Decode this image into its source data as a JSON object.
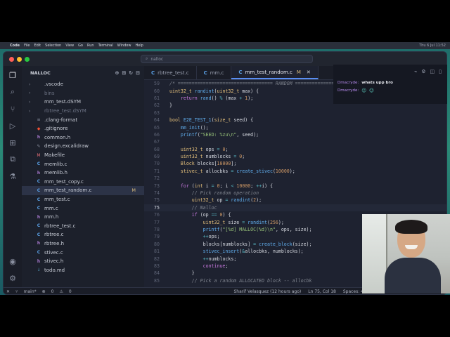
{
  "menubar": {
    "app": "Code",
    "items": [
      "File",
      "Edit",
      "Selection",
      "View",
      "Go",
      "Run",
      "Terminal",
      "Window",
      "Help"
    ],
    "clock": "Thu 6 Jul 11:52"
  },
  "window": {
    "search": "nalloc"
  },
  "sidebar": {
    "title": "NALLOC",
    "items": [
      {
        "label": ".vscode",
        "kind": "folder",
        "dim": false,
        "selected": false,
        "badge": ""
      },
      {
        "label": "bins",
        "kind": "folder",
        "dim": true,
        "selected": false,
        "badge": ""
      },
      {
        "label": "mm_test.dSYM",
        "kind": "folder",
        "dim": false,
        "selected": false,
        "badge": ""
      },
      {
        "label": "rbtree_test.dSYM",
        "kind": "folder",
        "dim": true,
        "selected": false,
        "badge": ""
      },
      {
        "label": ".clang-format",
        "kind": "clang",
        "dim": false,
        "selected": false,
        "badge": ""
      },
      {
        "label": ".gitignore",
        "kind": "git",
        "dim": false,
        "selected": false,
        "badge": ""
      },
      {
        "label": "common.h",
        "kind": "h",
        "dim": false,
        "selected": false,
        "badge": ""
      },
      {
        "label": "design.excalidraw",
        "kind": "draw",
        "dim": false,
        "selected": false,
        "badge": ""
      },
      {
        "label": "Makefile",
        "kind": "make",
        "dim": false,
        "selected": false,
        "badge": ""
      },
      {
        "label": "memlib.c",
        "kind": "c",
        "dim": false,
        "selected": false,
        "badge": ""
      },
      {
        "label": "memlib.h",
        "kind": "h",
        "dim": false,
        "selected": false,
        "badge": ""
      },
      {
        "label": "mm_test_copy.c",
        "kind": "c",
        "dim": false,
        "selected": false,
        "badge": ""
      },
      {
        "label": "mm_test_random.c",
        "kind": "c",
        "dim": false,
        "selected": true,
        "badge": "M"
      },
      {
        "label": "mm_test.c",
        "kind": "c",
        "dim": false,
        "selected": false,
        "badge": ""
      },
      {
        "label": "mm.c",
        "kind": "c",
        "dim": false,
        "selected": false,
        "badge": ""
      },
      {
        "label": "mm.h",
        "kind": "h",
        "dim": false,
        "selected": false,
        "badge": ""
      },
      {
        "label": "rbtree_test.c",
        "kind": "c",
        "dim": false,
        "selected": false,
        "badge": ""
      },
      {
        "label": "rbtree.c",
        "kind": "c",
        "dim": false,
        "selected": false,
        "badge": ""
      },
      {
        "label": "rbtree.h",
        "kind": "h",
        "dim": false,
        "selected": false,
        "badge": ""
      },
      {
        "label": "stivec.c",
        "kind": "c",
        "dim": false,
        "selected": false,
        "badge": ""
      },
      {
        "label": "stivec.h",
        "kind": "h",
        "dim": false,
        "selected": false,
        "badge": ""
      },
      {
        "label": "todo.md",
        "kind": "md",
        "dim": false,
        "selected": false,
        "badge": ""
      }
    ]
  },
  "tabs": [
    {
      "label": "rbtree_test.c",
      "active": false,
      "modified": ""
    },
    {
      "label": "mm.c",
      "active": false,
      "modified": ""
    },
    {
      "label": "mm_test_random.c",
      "active": true,
      "modified": "M"
    }
  ],
  "code": {
    "current_line": 75,
    "lines": [
      {
        "n": 59,
        "html": "<span class='cm'>/* ================================== RANDOM ==============</span>"
      },
      {
        "n": 60,
        "html": "<span class='ty'>uint32_t</span> <span class='fn'>randint</span>(<span class='ty'>uint32_t</span> max) {"
      },
      {
        "n": 61,
        "html": "    <span class='kw'>return</span> <span class='fn'>rand</span>() <span class='op'>%</span> (max <span class='op'>+</span> <span class='nu'>1</span>);"
      },
      {
        "n": 62,
        "html": "}"
      },
      {
        "n": 63,
        "html": ""
      },
      {
        "n": 64,
        "html": "<span class='ty'>bool</span> <span class='fn'>E2E_TEST_1</span>(<span class='ty'>size_t</span> seed) {"
      },
      {
        "n": 65,
        "html": "    <span class='fn'>mm_init</span>();"
      },
      {
        "n": 66,
        "html": "    <span class='fn'>printf</span>(<span class='st'>\"SEED: %zu\\n\"</span>, seed);"
      },
      {
        "n": 67,
        "html": ""
      },
      {
        "n": 68,
        "html": "    <span class='ty'>uint32_t</span> ops <span class='op'>=</span> <span class='nu'>0</span>;"
      },
      {
        "n": 69,
        "html": "    <span class='ty'>uint32_t</span> numblocks <span class='op'>=</span> <span class='nu'>0</span>;"
      },
      {
        "n": 70,
        "html": "    <span class='ty'>Block</span> blocks[<span class='nu'>10000</span>];"
      },
      {
        "n": 71,
        "html": "    <span class='ty'>stivec_t</span> allocbks <span class='op'>=</span> <span class='fn'>create_stivec</span>(<span class='nu'>10000</span>);"
      },
      {
        "n": 72,
        "html": ""
      },
      {
        "n": 73,
        "html": "    <span class='kw'>for</span> (<span class='ty'>int</span> i <span class='op'>=</span> <span class='nu'>0</span>; i <span class='op'>&lt;</span> <span class='nu'>10000</span>; <span class='op'>++</span>i) {"
      },
      {
        "n": 74,
        "html": "        <span class='cm'>// Pick random operation</span>"
      },
      {
        "n": 75,
        "html": "        <span class='ty'>uint32_t</span> op <span class='op'>=</span> <span class='fn'>randint</span>(<span class='nu'>2</span>);"
      },
      {
        "n": 75,
        "html": "        <span class='cm'>// Nalloc</span>"
      },
      {
        "n": 76,
        "html": "        <span class='kw'>if</span> (op <span class='op'>==</span> <span class='nu'>0</span>) {"
      },
      {
        "n": 77,
        "html": "            <span class='ty'>uint32_t</span> size <span class='op'>=</span> <span class='fn'>randint</span>(<span class='nu'>256</span>);"
      },
      {
        "n": 78,
        "html": "            <span class='fn'>printf</span>(<span class='st'>\"[%d] MALLOC(%d)\\n\"</span>, ops, size);"
      },
      {
        "n": 79,
        "html": "            <span class='op'>++</span>ops;"
      },
      {
        "n": 80,
        "html": "            blocks[numblocks] <span class='op'>=</span> <span class='fn'>create_block</span>(size);"
      },
      {
        "n": 81,
        "html": "            <span class='fn'>stivec_insert</span>(<span class='op'>&amp;</span>allocbks, numblocks);"
      },
      {
        "n": 82,
        "html": "            <span class='op'>++</span>numblocks;"
      },
      {
        "n": 83,
        "html": "            <span class='kw'>continue</span>;"
      },
      {
        "n": 84,
        "html": "        }"
      },
      {
        "n": 85,
        "html": "        <span class='cm'>// Pick a random ALLOCATED block -- allocbk</span>"
      }
    ]
  },
  "statusbar": {
    "branch": "main*",
    "errors": "0",
    "warnings": "0",
    "blame": "Sharif Velasquez (12 hours ago)",
    "position": "Ln 75, Col 18",
    "spaces": "Spaces: 4"
  },
  "chat": {
    "messages": [
      {
        "user": "Dmacryde:",
        "text": "whats upp bro"
      },
      {
        "user": "Dmacryde:",
        "text": ""
      }
    ]
  }
}
